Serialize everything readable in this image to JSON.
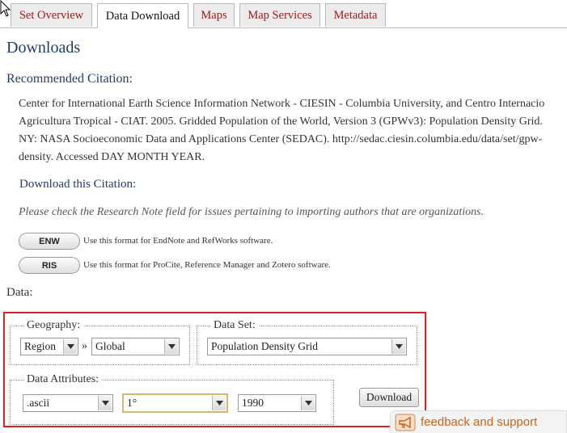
{
  "tabs": [
    {
      "label": "Set Overview",
      "active": false
    },
    {
      "label": "Data Download",
      "active": true
    },
    {
      "label": "Maps",
      "active": false
    },
    {
      "label": "Map Services",
      "active": false
    },
    {
      "label": "Metadata",
      "active": false
    }
  ],
  "page": {
    "title": "Downloads",
    "citation_heading": "Recommended Citation:",
    "citation_lines": [
      "Center for International Earth Science Information Network - CIESIN - Columbia University, and Centro Internacio",
      "Agricultura Tropical - CIAT. 2005. Gridded Population of the World, Version 3 (GPWv3): Population Density Grid.",
      "NY: NASA Socioeconomic Data and Applications Center (SEDAC). http://sedac.ciesin.columbia.edu/data/set/gpw-",
      "density. Accessed DAY MONTH YEAR."
    ],
    "download_citation_heading": "Download this Citation:",
    "citation_note": "Please check the Research Note field for issues pertaining to importing authors that are organizations.",
    "formats": [
      {
        "label": "ENW",
        "description": "Use this format for EndNote and RefWorks software."
      },
      {
        "label": "RIS",
        "description": "Use this format for ProCite, Reference Manager and Zotero software."
      }
    ],
    "data_heading": "Data:"
  },
  "data_form": {
    "geography": {
      "legend": "Geography:",
      "level": "Region",
      "separator": "»",
      "region": "Global"
    },
    "dataset": {
      "legend": "Data Set:",
      "value": "Population Density Grid"
    },
    "attributes": {
      "legend": "Data Attributes:",
      "format": ".ascii",
      "resolution": "1°",
      "year": "1990"
    },
    "download_label": "Download"
  },
  "feedback": {
    "label": "feedback and support",
    "icon": "megaphone-icon"
  },
  "colors": {
    "tab_text": "#9b1c1c",
    "heading": "#1f3d6b",
    "highlight_box": "#e02020",
    "feedback_text": "#c4661f"
  }
}
